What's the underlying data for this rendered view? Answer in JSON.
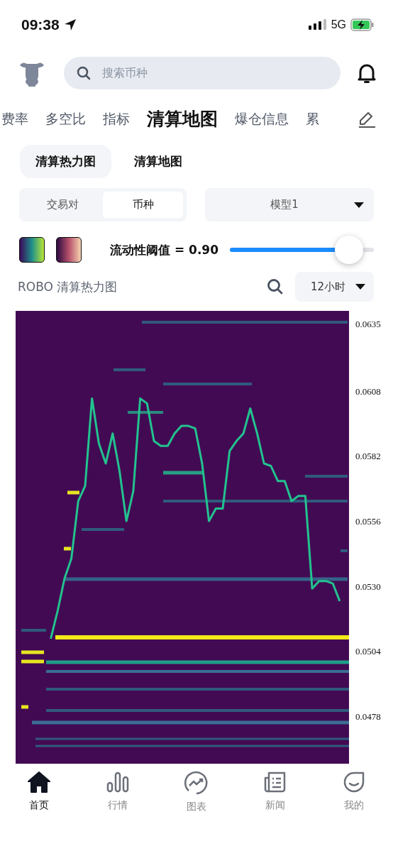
{
  "status_bar": {
    "time": "09:38",
    "network": "5G"
  },
  "search": {
    "placeholder": "搜索币种"
  },
  "tabs": [
    {
      "label": "费率",
      "selected": false
    },
    {
      "label": "多空比",
      "selected": false
    },
    {
      "label": "指标",
      "selected": false
    },
    {
      "label": "清算地图",
      "selected": true
    },
    {
      "label": "爆仓信息",
      "selected": false
    },
    {
      "label": "累",
      "selected": false
    }
  ],
  "subtabs": [
    {
      "label": "清算热力图",
      "selected": true
    },
    {
      "label": "清算地图",
      "selected": false
    }
  ],
  "segment": [
    {
      "label": "交易对",
      "selected": false
    },
    {
      "label": "币种",
      "selected": true
    }
  ],
  "model_dropdown": {
    "value": "模型1"
  },
  "threshold": {
    "label": "流动性阈值 = 0.90",
    "level": 0.83
  },
  "chart_header": {
    "title": "ROBO 清算热力图",
    "interval": "12小时"
  },
  "chart_data": {
    "type": "line",
    "ylim": [
      0.0459,
      0.064
    ],
    "yticks": [
      {
        "value": 0.0635,
        "label": "0.0635"
      },
      {
        "value": 0.0608,
        "label": "0.0608"
      },
      {
        "value": 0.0582,
        "label": "0.0582"
      },
      {
        "value": 0.0556,
        "label": "0.0556"
      },
      {
        "value": 0.053,
        "label": "0.0530"
      },
      {
        "value": 0.0504,
        "label": "0.0504"
      },
      {
        "value": 0.0478,
        "label": "0.0478"
      }
    ],
    "series": [
      {
        "color": "#22c38e",
        "values": [
          0.0509,
          0.052,
          0.0533,
          0.0541,
          0.0564,
          0.057,
          0.0605,
          0.0587,
          0.0579,
          0.0591,
          0.0576,
          0.0556,
          0.0568,
          0.0605,
          0.0603,
          0.0588,
          0.0586,
          0.0586,
          0.0591,
          0.0594,
          0.0594,
          0.0593,
          0.0579,
          0.0556,
          0.0561,
          0.0561,
          0.0584,
          0.0588,
          0.0591,
          0.0601,
          0.0591,
          0.0579,
          0.0578,
          0.0572,
          0.0572,
          0.0564,
          0.0566,
          0.0566,
          0.0529,
          0.0532,
          0.0532,
          0.0531,
          0.0524
        ]
      }
    ]
  },
  "nav": [
    {
      "label": "首页",
      "selected": true
    },
    {
      "label": "行情",
      "selected": false
    },
    {
      "label": "图表",
      "selected": false
    },
    {
      "label": "新闻",
      "selected": false
    },
    {
      "label": "我的",
      "selected": false
    }
  ]
}
